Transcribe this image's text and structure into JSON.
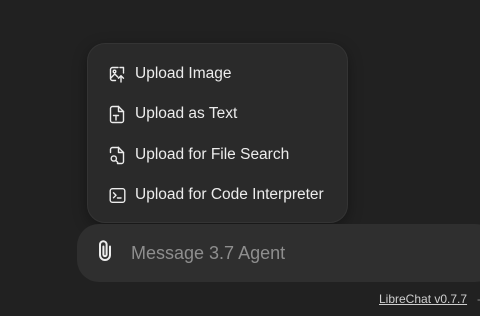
{
  "attach_menu": {
    "items": [
      {
        "label": "Upload Image",
        "icon": "image-upload-icon"
      },
      {
        "label": "Upload as Text",
        "icon": "file-text-icon"
      },
      {
        "label": "Upload for File Search",
        "icon": "file-search-icon"
      },
      {
        "label": "Upload for Code Interpreter",
        "icon": "terminal-icon"
      }
    ]
  },
  "composer": {
    "placeholder": "Message 3.7 Agent",
    "attach_icon": "paperclip-icon"
  },
  "footer": {
    "version_link": "LibreChat v0.7.7"
  },
  "colors": {
    "background": "#212121",
    "menu_background": "#2a2a2a",
    "composer_background": "#2f2f2f",
    "text": "#ececec",
    "placeholder": "#8e8e8e"
  }
}
